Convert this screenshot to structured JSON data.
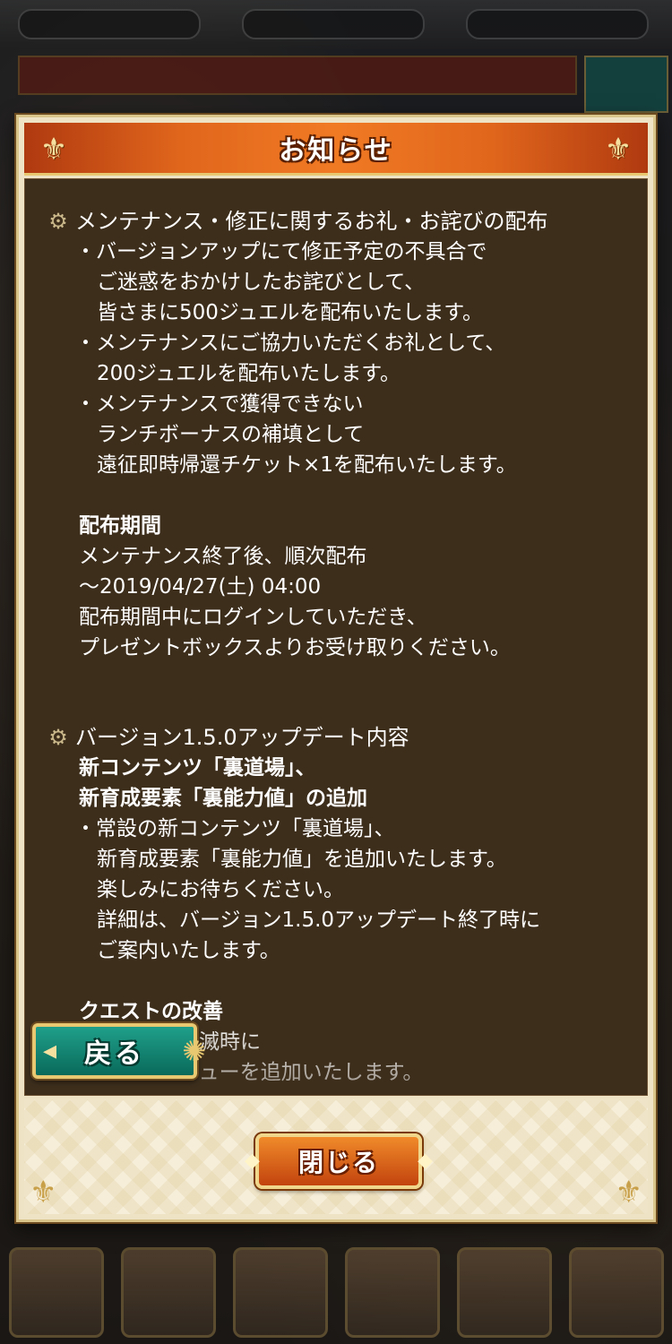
{
  "dialog": {
    "title": "お知らせ",
    "close_label": "閉じる",
    "back_label": "戻る"
  },
  "sections": [
    {
      "heading": "メンテナンス・修正に関するお礼・お詫びの配布",
      "bullets": [
        "・バージョンアップにて修正予定の不具合で\nご迷惑をおかけしたお詫びとして、\n皆さまに500ジュエルを配布いたします。",
        "・メンテナンスにご協力いただくお礼として、\n200ジュエルを配布いたします。",
        "・メンテナンスで獲得できない\nランチボーナスの補填として\n遠征即時帰還チケット×1を配布いたします。"
      ],
      "period_heading": "配布期間",
      "period_text": "メンテナンス終了後、順次配布\n〜2019/04/27(土) 04:00\n配布期間中にログインしていただき、\nプレゼントボックスよりお受け取りください。"
    },
    {
      "heading": "バージョン1.5.0アップデート内容",
      "sub_heading": "新コンテンツ「裏道場」、\n新育成要素「裏能力値」の追加",
      "bullets": [
        "・常設の新コンテンツ「裏道場」、\n新育成要素「裏能力値」を追加いたします。\n楽しみにお待ちください。\n詳細は、バージョン1.5.0アップデート終了時に\nご案内いたします。"
      ],
      "sub_heading_2": "クエストの改善",
      "partial_text": "・クエスト全滅時に\nコンティニューを追加いたします。"
    }
  ],
  "colors": {
    "header": "#e0661c",
    "content_bg": "#3d2e1c",
    "back_button": "#0a6a5a",
    "close_button": "#c2440e"
  },
  "icons": {
    "section_marker": "gear-icon",
    "corner": "fleur-de-lis-icon"
  }
}
